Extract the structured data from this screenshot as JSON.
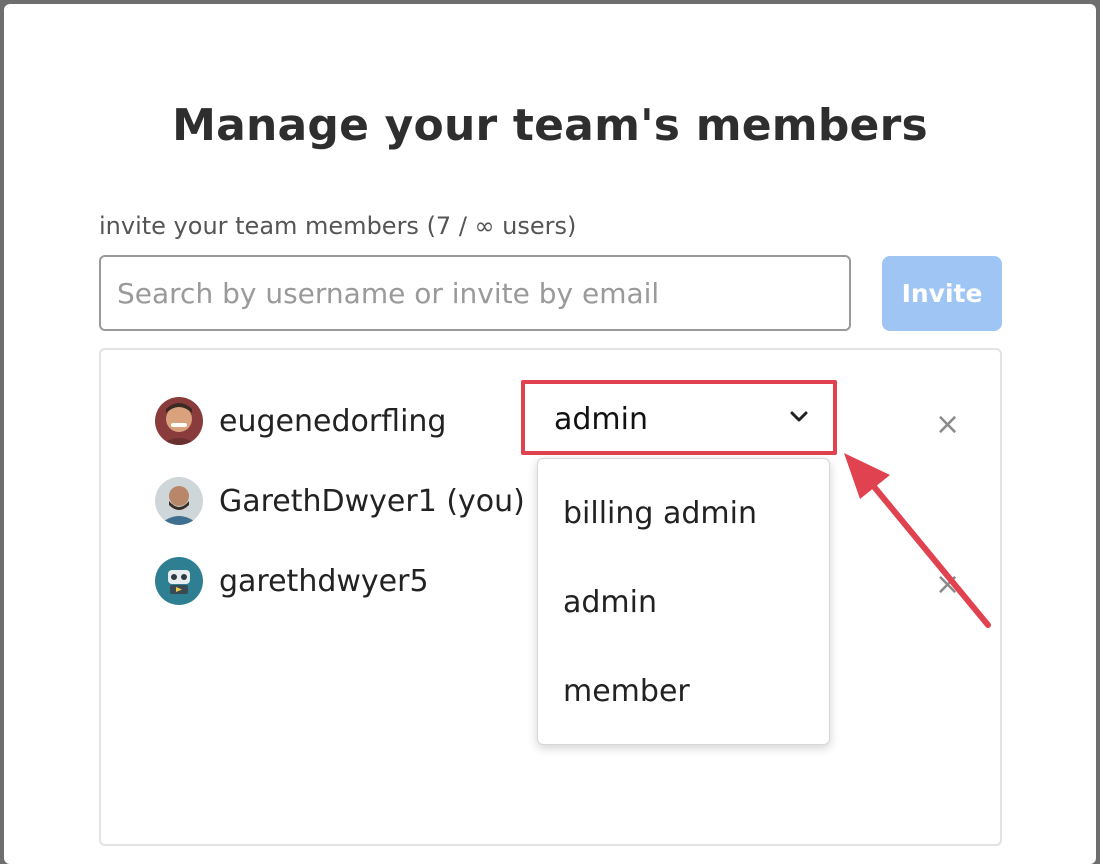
{
  "modal": {
    "title": "Manage your team's members",
    "invite_label": "invite your team members (7 / ∞ users)",
    "search_placeholder": "Search by username or invite by email",
    "invite_button": "Invite"
  },
  "members": [
    {
      "name": "eugenedorfling",
      "avatar": "photo-avatar",
      "role": "admin"
    },
    {
      "name": "GarethDwyer1 (you)",
      "avatar": "photo-avatar"
    },
    {
      "name": "garethdwyer5",
      "avatar": "robot-avatar"
    }
  ],
  "role_dropdown": {
    "selected": "admin",
    "options": [
      "billing admin",
      "admin",
      "member"
    ],
    "highlight_color": "#e0434f"
  },
  "icons": {
    "remove": "×",
    "chevron": "chevron-down-icon"
  },
  "colors": {
    "invite_button_bg": "#9ec5f3",
    "annotation_red": "#e0434f"
  }
}
